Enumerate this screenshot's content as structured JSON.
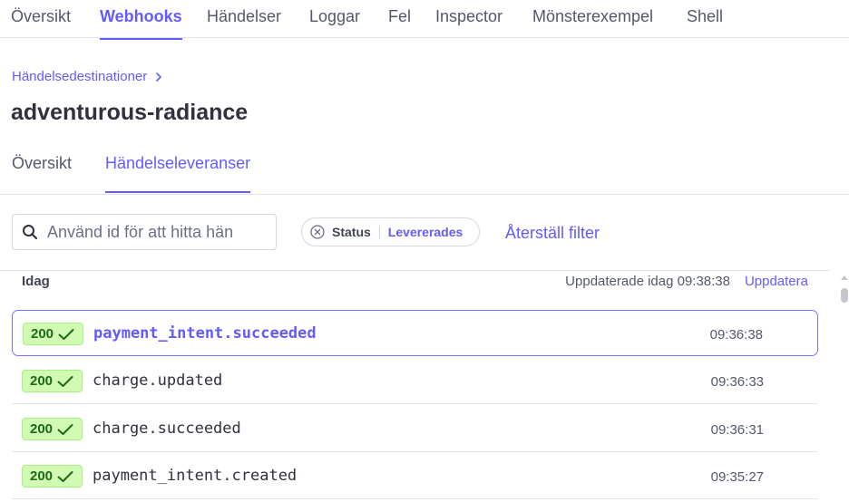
{
  "top_tabs": [
    {
      "label": "Översikt"
    },
    {
      "label": "Webhooks",
      "active": true
    },
    {
      "label": "Händelser"
    },
    {
      "label": "Loggar"
    },
    {
      "label": "Fel"
    },
    {
      "label": "Inspector"
    },
    {
      "label": "Mönsterexempel"
    },
    {
      "label": "Shell"
    }
  ],
  "breadcrumb": {
    "label": "Händelsedestinationer"
  },
  "page_title": "adventurous-radiance",
  "sub_tabs": [
    {
      "label": "Översikt"
    },
    {
      "label": "Händelseleveranser",
      "active": true
    }
  ],
  "search": {
    "placeholder": "Använd id för att hitta hän",
    "value": ""
  },
  "filter": {
    "name": "Status",
    "value": "Levererades"
  },
  "reset_filter_label": "Återställ filter",
  "list": {
    "day_label": "Idag",
    "updated_text": "Uppdaterade idag 09:38:38",
    "refresh_label": "Uppdatera",
    "events": [
      {
        "status": "200",
        "name": "payment_intent.succeeded",
        "time": "09:36:38",
        "selected": true
      },
      {
        "status": "200",
        "name": "charge.updated",
        "time": "09:36:33"
      },
      {
        "status": "200",
        "name": "charge.succeeded",
        "time": "09:36:31"
      },
      {
        "status": "200",
        "name": "payment_intent.created",
        "time": "09:35:27"
      }
    ]
  },
  "colors": {
    "accent": "#635bff",
    "success_bg": "#d1fab3",
    "success_text": "#1e6a1a"
  },
  "icons": {
    "search": "search-icon",
    "clear_filter": "x-circle-icon",
    "breadcrumb": "chevron-right-icon",
    "status": "checkmark-icon"
  }
}
